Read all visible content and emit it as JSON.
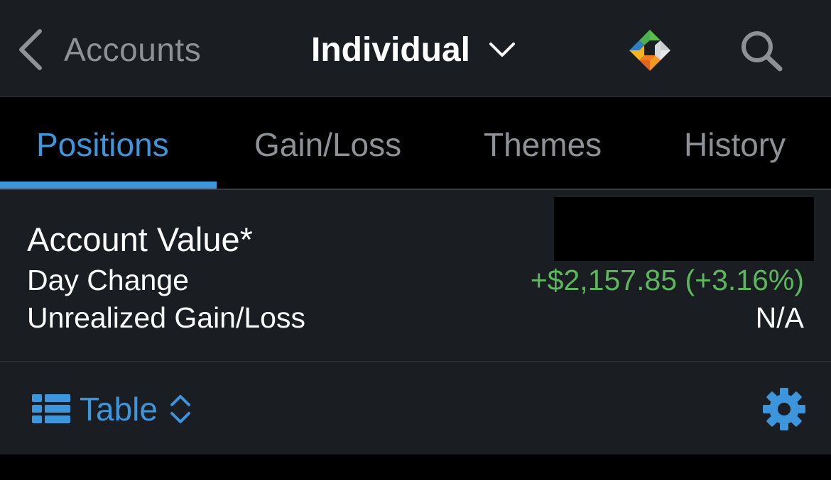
{
  "header": {
    "back_label": "Accounts",
    "account_title": "Individual",
    "logo_icon": "multicolor-diamond-logo",
    "search_icon": "search-icon"
  },
  "tabs": [
    {
      "label": "Positions",
      "active": true
    },
    {
      "label": "Gain/Loss",
      "active": false
    },
    {
      "label": "Themes",
      "active": false
    },
    {
      "label": "History",
      "active": false
    }
  ],
  "summary": {
    "account_value_label": "Account Value*",
    "account_value": "",
    "day_change_label": "Day Change",
    "day_change_value": "+$2,157.85 (+3.16%)",
    "unrealized_label": "Unrealized Gain/Loss",
    "unrealized_value": "N/A"
  },
  "toolbar": {
    "view_label": "Table",
    "view_icon": "table-grid-icon",
    "settings_icon": "gear-icon"
  },
  "colors": {
    "accent": "#3d95db",
    "positive": "#5cb85c",
    "background": "#1a1d21",
    "muted_text": "#8e9297"
  }
}
